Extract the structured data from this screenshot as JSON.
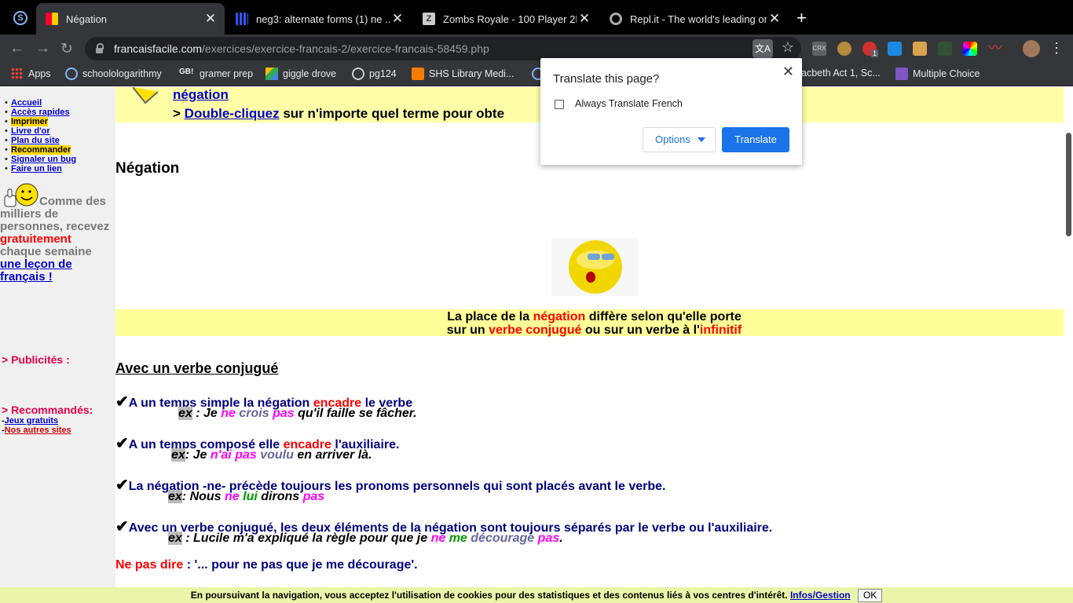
{
  "tabs": [
    {
      "title": "Négation",
      "icon": "colorful-squares-icon",
      "active": true
    },
    {
      "title": "neg3: alternate forms (1) ne ...",
      "icon": "dots-icon"
    },
    {
      "title": "Zombs Royale - 100 Player 2D",
      "icon": "z-icon"
    },
    {
      "title": "Repl.it - The world's leading on",
      "icon": "replit-icon"
    }
  ],
  "address": {
    "domain": "francaisfacile.com",
    "path": "/exercices/exercice-francais-2/exercice-francais-58459.php"
  },
  "bookmarks": [
    {
      "label": "Apps"
    },
    {
      "label": "schoolologarithmy"
    },
    {
      "label": "gramer prep"
    },
    {
      "label": "giggle drove"
    },
    {
      "label": "pg124"
    },
    {
      "label": "SHS Library Medi..."
    },
    {
      "label": "acbeth Act 1, Sc..."
    },
    {
      "label": "Multiple Choice"
    }
  ],
  "ext_badge": "1",
  "translate_popup": {
    "title": "Translate this page?",
    "checkbox_label": "Always Translate French",
    "options_label": "Options",
    "translate_label": "Translate"
  },
  "sidebar": {
    "items": [
      "Accueil",
      "Accès rapides",
      "Imprimer",
      "Livre d'or",
      "Plan du site",
      "Recommander",
      "Signaler un bug",
      "Faire un lien"
    ],
    "promo": {
      "p1": "Comme des milliers de personnes, recevez",
      "p2": "gratuitement",
      "p3": "chaque semaine",
      "p4": "une leçon de français !"
    },
    "pub_heading": "> Publicités :",
    "rec_heading": "> Recommandés:",
    "rec_links": [
      "Jeux gratuits",
      "Nos autres sites"
    ]
  },
  "banner": {
    "line1": "négation",
    "prefix": ">",
    "link": "Double-cliquez",
    "rest": "sur n'importe quel terme pour obte"
  },
  "page_title": "Négation",
  "intro": {
    "a": "La place de la",
    "b": "négation",
    "c": "diffère selon qu'elle porte",
    "d": "sur un",
    "e": "verbe conjugué",
    "f": "ou sur un verbe à l'",
    "g": "infinitif"
  },
  "section_heading": "Avec un verbe conjugué",
  "rules": [
    {
      "a": "A un temps simple la négation",
      "b": "encadre",
      "c": "le verbe"
    },
    {
      "a": "A un temps composé elle",
      "b": "encadre",
      "c": "l'auxiliaire."
    },
    {
      "a": "La négation -ne- précède toujours les pronoms personnels qui sont placés avant le verbe."
    },
    {
      "a": "Avec un verbe conjugué, les deux éléments de la négation sont toujours séparés par le verbe ou l'auxiliaire."
    }
  ],
  "examples": {
    "lab": "ex",
    "e1": {
      "a": " : Je ",
      "b": "ne",
      "c": "crois",
      "d": "pas",
      "e": " qu'il faille se fâcher."
    },
    "e2": {
      "a": ": Je ",
      "b": "n'ai",
      "c": "pas",
      "d": "voulu",
      "e": " en arriver là."
    },
    "e3": {
      "a": ": Nous ",
      "b": "ne",
      "c": "lui",
      "d": "dirons",
      "e": "pas"
    },
    "e4": {
      "a": " : Lucile m'a expliqué la règle pour que je ",
      "b": "ne",
      "c": "me",
      "d": "décourage",
      "e": "pas",
      "f": "."
    }
  },
  "ne_pas_dire": {
    "a": "Ne pas dire",
    "b": " : '... pour ne pas que je me décourage'."
  },
  "cookie": {
    "text": "En poursuivant la navigation, vous acceptez l'utilisation de cookies pour des statistiques et des contenus liés à vos centres d'intérêt.",
    "link": "Infos/Gestion",
    "ok": "OK"
  }
}
